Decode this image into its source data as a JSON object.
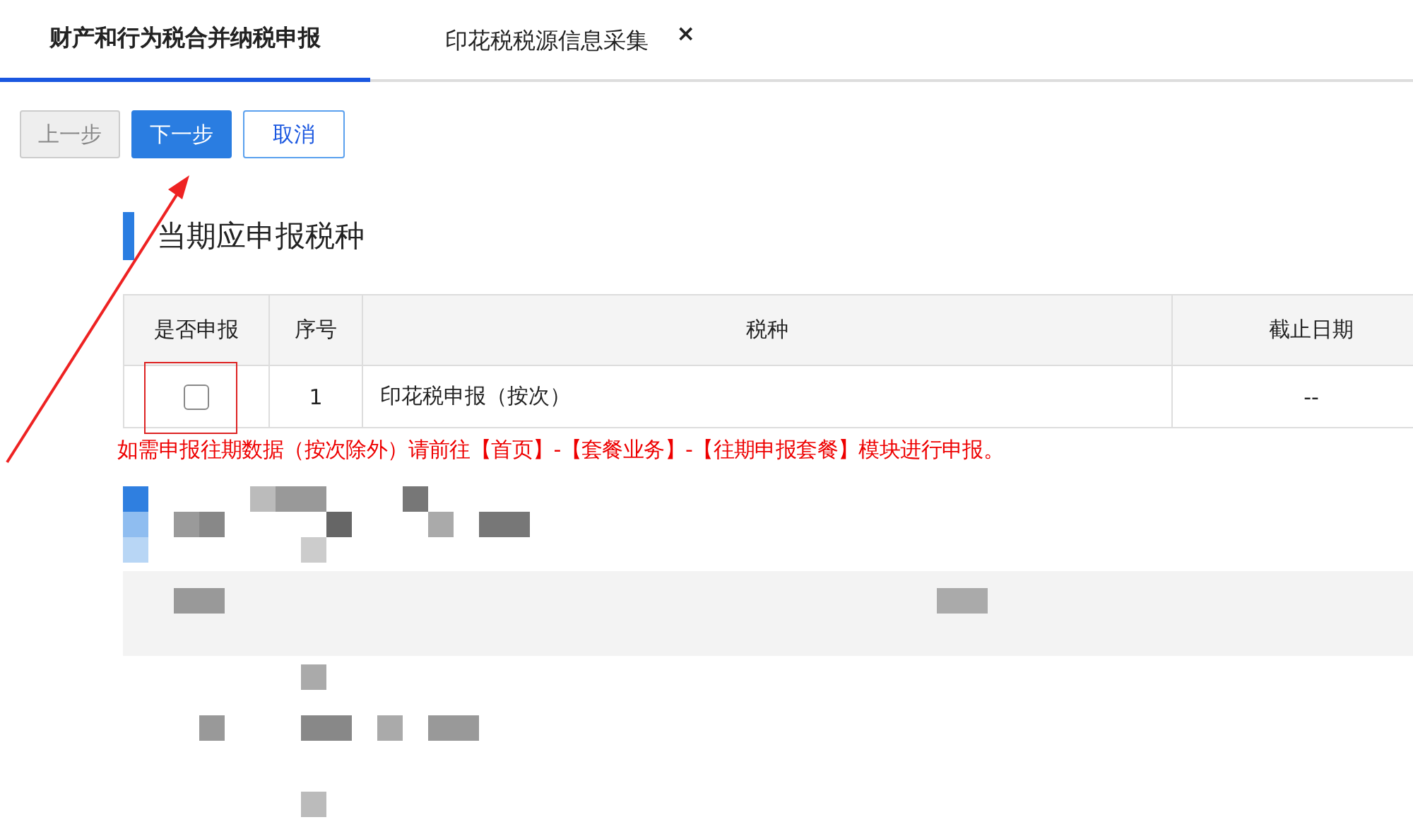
{
  "tabs": [
    {
      "label": "财产和行为税合并纳税申报",
      "selected": true
    },
    {
      "label": "印花税税源信息采集",
      "selected": false,
      "close": "×"
    }
  ],
  "buttons": [
    {
      "label": "上一步",
      "kind": "default",
      "disabled": true
    },
    {
      "label": "下一步",
      "kind": "primary",
      "disabled": false
    },
    {
      "label": "取消",
      "kind": "outline",
      "disabled": false
    }
  ],
  "section": {
    "title": "当期应申报税种"
  },
  "table": {
    "columns": [
      "是否申报",
      "序号",
      "税种",
      "截止日期"
    ],
    "rows": [
      {
        "checked": false,
        "index": "1",
        "tax": "印花税申报（按次）",
        "deadline": "--"
      }
    ]
  },
  "note": "如需申报往期数据（按次除外）请前往【首页】-【套餐业务】-【往期申报套餐】模块进行申报。"
}
